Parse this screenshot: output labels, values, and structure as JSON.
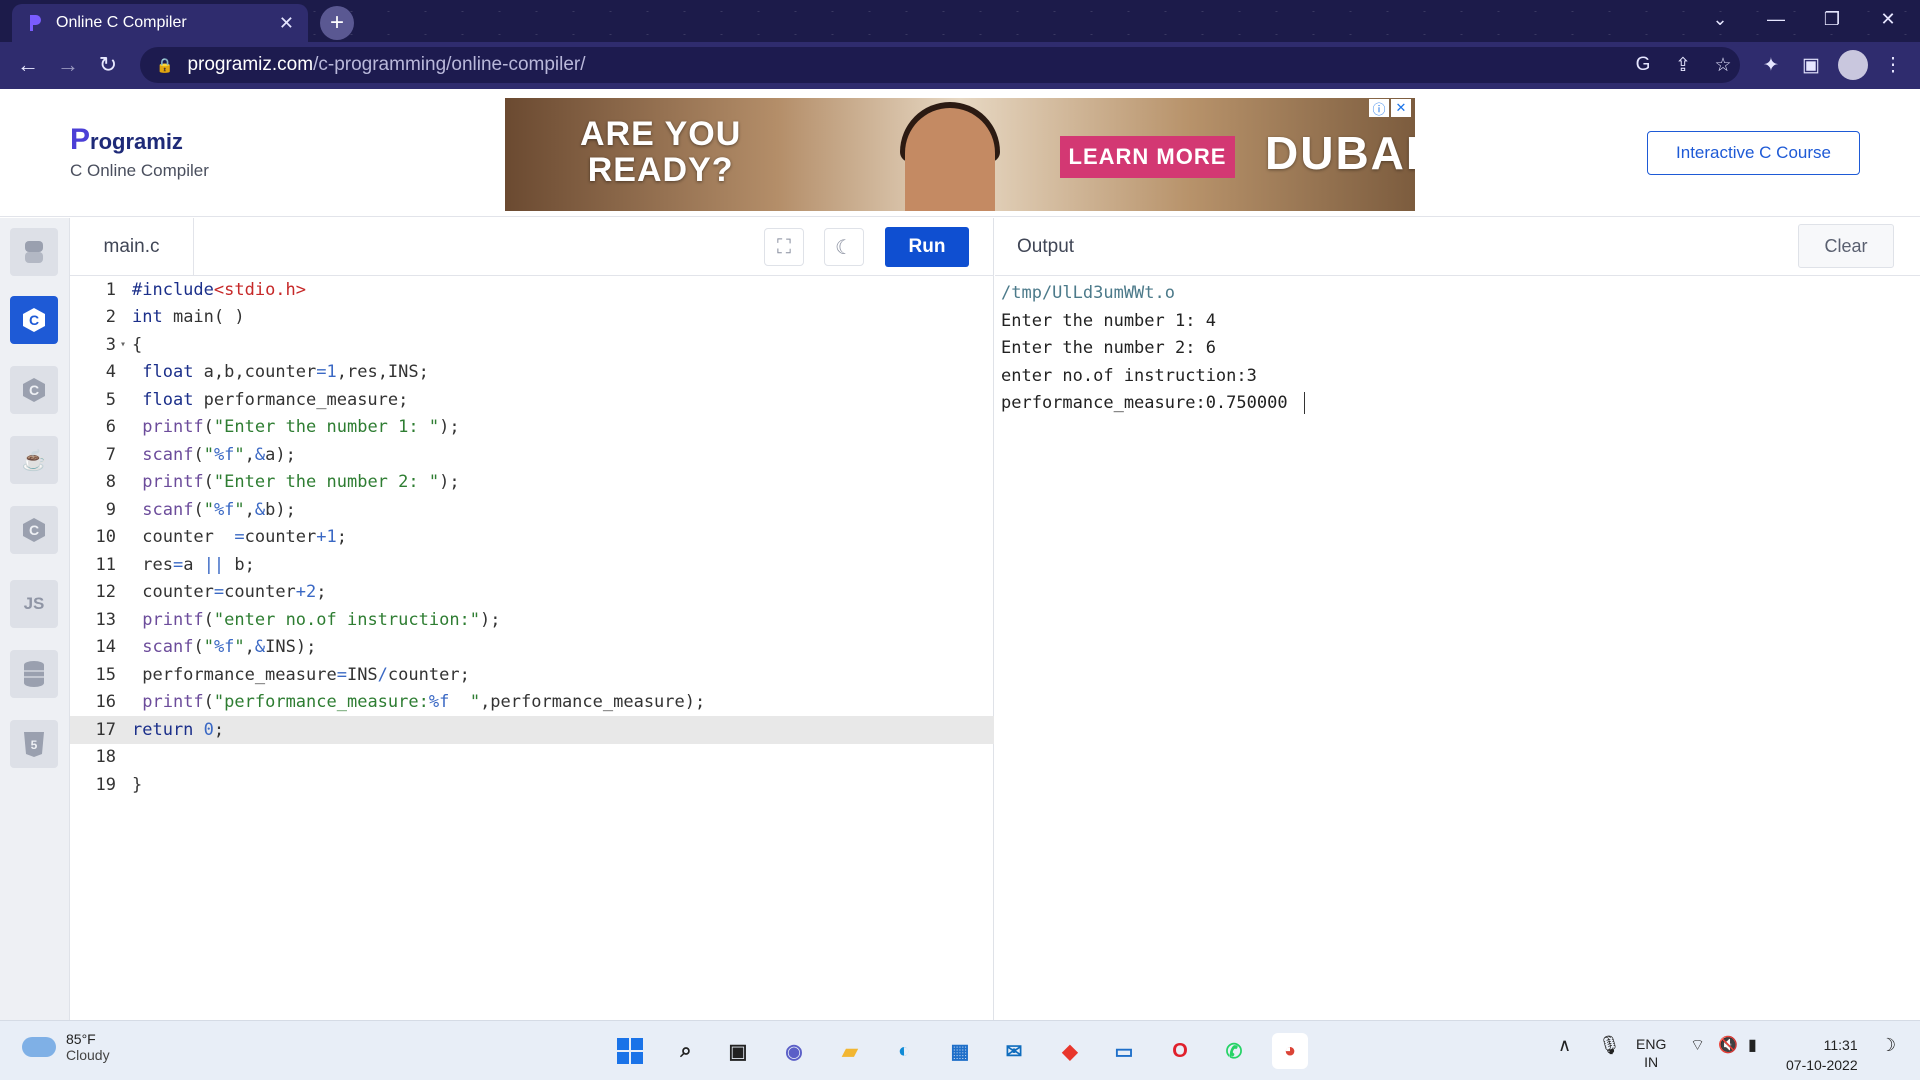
{
  "browser": {
    "tab_title": "Online C Compiler",
    "url_host": "programiz.com",
    "url_path": "/c-programming/online-compiler/"
  },
  "header": {
    "logo": "rogramiz",
    "subtitle": "C Online Compiler",
    "course_button": "Interactive C Course",
    "ad": {
      "headline_line1": "ARE YOU",
      "headline_line2": "READY?",
      "cta": "LEARN MORE",
      "brand": "DUBAI"
    }
  },
  "sidebar": {
    "languages": [
      {
        "name": "python-icon",
        "glyph": "🐍"
      },
      {
        "name": "c-icon",
        "glyph": "C"
      },
      {
        "name": "cpp-icon",
        "glyph": "C"
      },
      {
        "name": "java-icon",
        "glyph": "☕"
      },
      {
        "name": "csharp-icon",
        "glyph": "C"
      },
      {
        "name": "javascript-icon",
        "glyph": "JS"
      },
      {
        "name": "sql-icon",
        "glyph": "≡"
      },
      {
        "name": "html-icon",
        "glyph": "5"
      }
    ]
  },
  "editor": {
    "file_name": "main.c",
    "run_label": "Run"
  },
  "output": {
    "title": "Output",
    "clear_label": "Clear",
    "lines": [
      "/tmp/UlLd3umWWt.o",
      "Enter the number 1: 4",
      "Enter the number 2: 6",
      "enter no.of instruction:3",
      "performance_measure:0.750000"
    ]
  },
  "taskbar": {
    "temperature": "85°F",
    "condition": "Cloudy",
    "lang1": "ENG",
    "lang2": "IN",
    "time": "11:31",
    "date": "07-10-2022"
  }
}
